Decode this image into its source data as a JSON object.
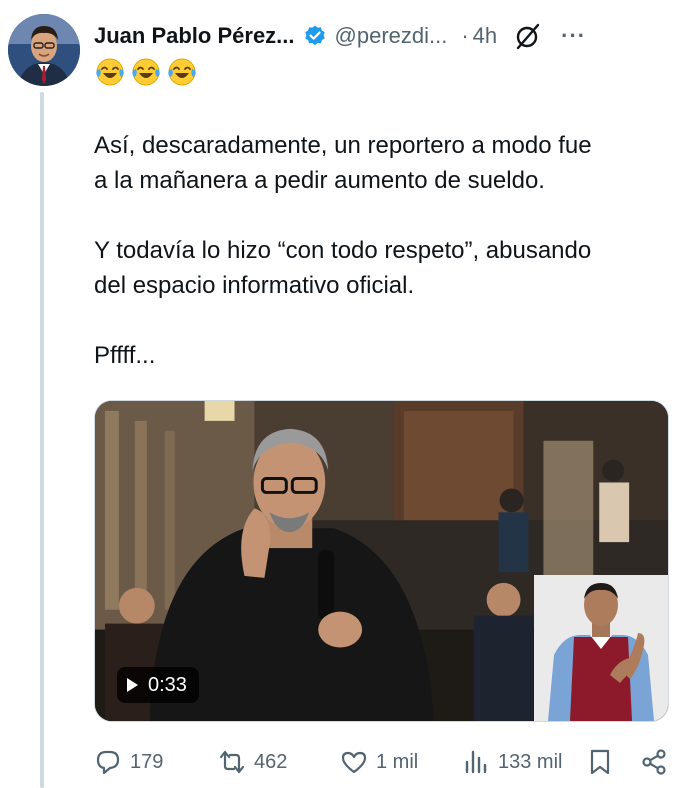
{
  "author": {
    "name": "Juan Pablo Pérez...",
    "handle": "@perezdi...",
    "separator": "·",
    "time": "4h"
  },
  "emoji_line": "😂😂😂",
  "tweet": {
    "paragraphs": [
      "Así, descaradamente, un reportero a modo fue\na la mañanera a pedir aumento de sueldo.",
      "Y todavía lo hizo “con todo respeto”, abusando\ndel espacio informativo oficial.",
      "Pffff..."
    ]
  },
  "video": {
    "duration": "0:33"
  },
  "actions": {
    "replies": "179",
    "reposts": "462",
    "likes": "1 mil",
    "views": "133 mil"
  },
  "colors": {
    "secondary_text": "#536471",
    "verified_blue": "#1d9bf0",
    "thread_line": "#cfd9de"
  }
}
